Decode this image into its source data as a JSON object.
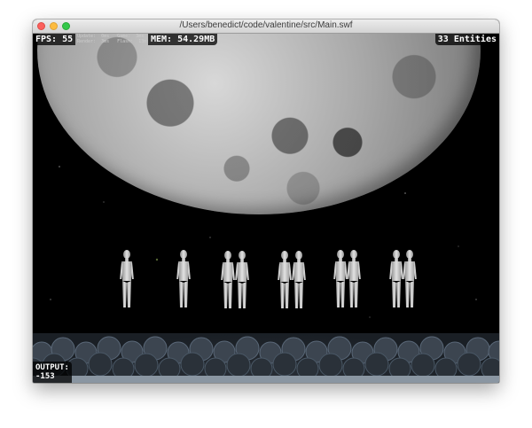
{
  "window": {
    "title": "/Users/benedict/code/valentine/src/Main.swf"
  },
  "hud": {
    "fps_label": "FPS: 55",
    "stats_update_label": "Update:",
    "stats_update_value": "0ms",
    "stats_game_label": "Game:",
    "stats_game_value": "3ms",
    "stats_render_label": "Render:",
    "stats_render_value": "3ms",
    "stats_flash_label": "Flash:",
    "stats_flash_value": "13ms",
    "mem_label": "MEM: 54.29MB",
    "entities_label": "33 Entities",
    "output_label": "OUTPUT:",
    "output_value": "-153"
  },
  "colors": {
    "background": "#000000",
    "hud_text": "#ffffff",
    "moon": "#a8a8a8",
    "figure": "#d0d0d0"
  }
}
